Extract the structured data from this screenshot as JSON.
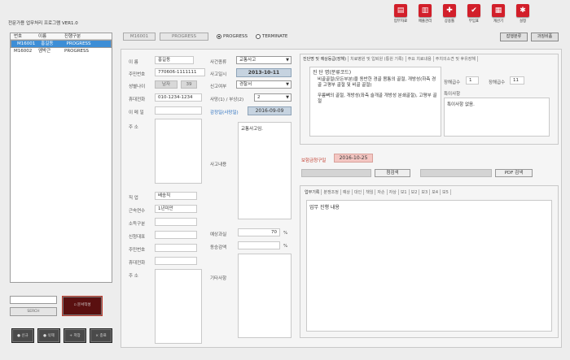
{
  "app_title": "전문가용 업무처리 프로그램 VER1.0",
  "toolbar": [
    {
      "label": "업무자료",
      "icon": "document-icon",
      "glyph": "▤"
    },
    {
      "label": "매출관리",
      "icon": "sales-icon",
      "glyph": "▥"
    },
    {
      "label": "상용툴",
      "icon": "plus-icon",
      "glyph": "✚"
    },
    {
      "label": "부임표",
      "icon": "check-icon",
      "glyph": "✔"
    },
    {
      "label": "계산기",
      "icon": "calculator-icon",
      "glyph": "▦"
    },
    {
      "label": "설정",
      "icon": "gear-icon",
      "glyph": "✱"
    }
  ],
  "list": {
    "headers": [
      "번호",
      "이름",
      "진행구분"
    ],
    "rows": [
      {
        "no": "M16001",
        "name": "홍길동",
        "status": "PROGRESS",
        "selected": true
      },
      {
        "no": "M16002",
        "name": "엠박근",
        "status": "PROGRESS",
        "selected": false
      }
    ]
  },
  "search": {
    "value": "",
    "button": "SERCH"
  },
  "side_buttons": {
    "register": "문서작성",
    "bottom": [
      "신규",
      "삭제",
      "저장",
      "종료"
    ]
  },
  "top": {
    "case_no": "M16001",
    "status_box": "PROGRESS",
    "radios": [
      {
        "label": "PROGRESS",
        "checked": true
      },
      {
        "label": "TERMINATE",
        "checked": false
      }
    ],
    "right_buttons": [
      "잡행분류",
      "과징비품"
    ]
  },
  "person": {
    "name_label": "이 름",
    "name": "홍길동",
    "rrn_label": "주민번호",
    "rrn": "770606-1111111",
    "gender_label": "성별나이",
    "gender": "남자",
    "age": "39",
    "phone_label": "휴대전화",
    "phone": "010-1234-1234",
    "email_label": "이 메 일",
    "email": "",
    "address_label": "주 소",
    "address": "",
    "job_label": "직 업",
    "job": "배송직",
    "years_label": "근속연수",
    "years": "1년미만",
    "income_label": "소득구분",
    "income": "",
    "rep_label": "신청대표",
    "rep": "",
    "rep_rrn_label": "주민번호",
    "rep_rrn": "",
    "rep_phone_label": "휴대전화",
    "rep_phone": "",
    "rep_addr_label": "주 소",
    "rep_addr": ""
  },
  "accident": {
    "type_label": "사건종류",
    "type": "교통사고",
    "date_label": "사고일시",
    "date": "2013-10-11",
    "report_label": "신고여부",
    "report": "경찰서",
    "death_label": "사망(1) / 부상(2)",
    "death": "2",
    "appraisal_label": "감정일(사망일)",
    "appraisal": "2016-09-09",
    "content_label": "사고내용",
    "content": "교통사고임.",
    "fault_label": "예상과실",
    "fault": "70",
    "fault_unit": "%",
    "dong_label": "동승감액",
    "dong": "",
    "dong_unit": "%",
    "etc_label": "기타사항",
    "etc": ""
  },
  "diagnosis": {
    "tabs": [
      "진단명 및 예상등급(장해)",
      "치료병원 및 입퇴원 (통원 기록)",
      "주요 치료내용",
      "주치의소견 및 후유장해"
    ],
    "title": "진 단 명(분류코드)",
    "text1": "비골골절(모든부분)을 동반한 경골 몸통의 골절, 개방성(하측 경골 고평부 골절 및 비골 골절)",
    "text2": "무릎뼈의 골절, 개방성(좌측 슬개골 개방성 분쇄골절), 고평부 골절",
    "grade_label": "장해급수",
    "grade": "1",
    "grade2_label": "장해급수",
    "grade2": "11",
    "special_label": "특이사항",
    "special": "특이사항 없음."
  },
  "insurance": {
    "claim_label": "보험금청구일",
    "claim_date": "2016-10-25",
    "search_button": "첨검색",
    "pdf_button": "PDF 검색"
  },
  "work": {
    "tabs": [
      "업무기록",
      "분쟁조정",
      "예상",
      "대인",
      "책임",
      "자손",
      "자상",
      "보1",
      "보2",
      "보3",
      "보4",
      "보5"
    ],
    "title": "업무 진행 내용"
  }
}
